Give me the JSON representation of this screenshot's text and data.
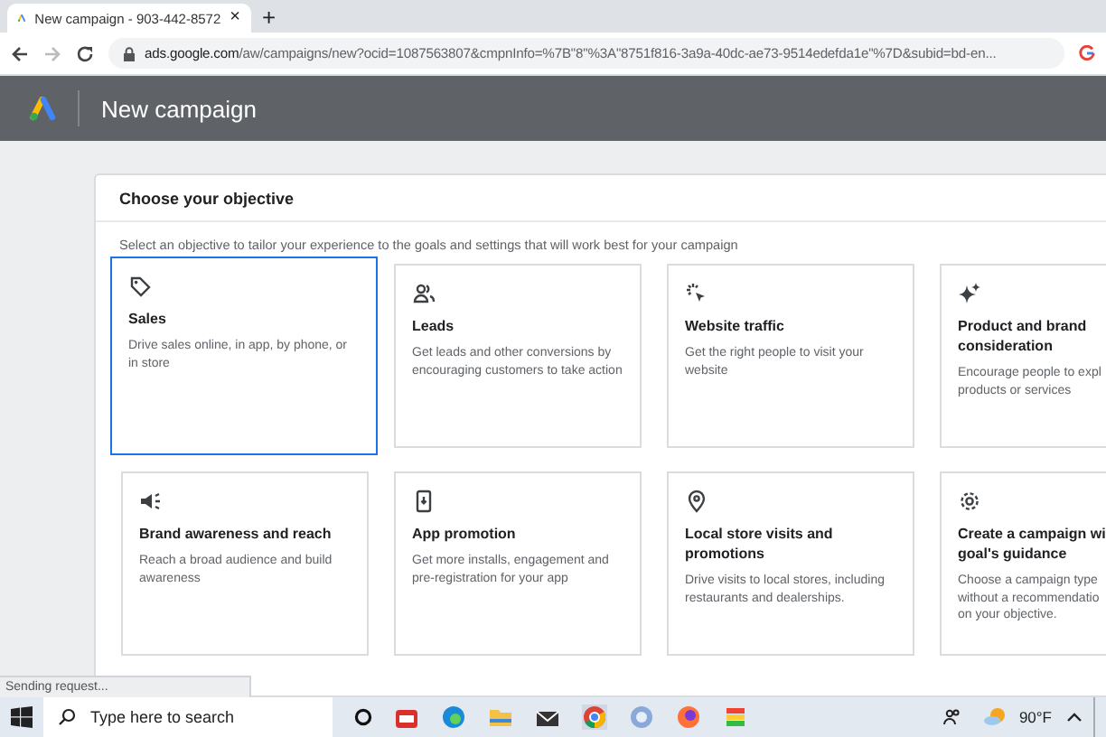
{
  "browser": {
    "tab_title": "New campaign - 903-442-8572",
    "tab_close": "×",
    "new_tab": "+",
    "url_host": "ads.google.com",
    "url_path": "/aw/campaigns/new?ocid=1087563807&cmpnInfo=%7B\"8\"%3A\"8751f816-3a9a-40dc-ae73-9514edefda1e\"%7D&subid=bd-en..."
  },
  "app_header": {
    "title": "New campaign"
  },
  "objective_card": {
    "title": "Choose your objective",
    "subtitle": "Select an objective to tailor your experience to the goals and settings that will work best for your campaign",
    "tiles": [
      {
        "kind": "tag",
        "title": "Sales",
        "description": "Drive sales online, in app, by phone, or in store",
        "selected": true
      },
      {
        "kind": "people",
        "title": "Leads",
        "description": "Get leads and other conversions by encouraging customers to take action",
        "selected": false
      },
      {
        "kind": "cursor",
        "title": "Website traffic",
        "description": "Get the right people to visit your website",
        "selected": false
      },
      {
        "kind": "sparkle",
        "title": "Product and brand consideration",
        "description": "Encourage people to expl products or services",
        "selected": false
      },
      {
        "kind": "megaphone",
        "title": "Brand awareness and reach",
        "description": "Reach a broad audience and build awareness",
        "selected": false
      },
      {
        "kind": "phone",
        "title": "App promotion",
        "description": "Get more installs, engagement and pre-registration for your app",
        "selected": false
      },
      {
        "kind": "pin",
        "title": "Local store visits and promotions",
        "description": "Drive visits to local stores, including restaurants and dealerships.",
        "selected": false
      },
      {
        "kind": "gear",
        "title": "Create a campaign wi goal's guidance",
        "description": "Choose a campaign type without a recommendatio on your objective.",
        "selected": false
      }
    ]
  },
  "status_bubble": "Sending request...",
  "taskbar": {
    "search_placeholder": "Type here to search",
    "weather": "90°F"
  }
}
